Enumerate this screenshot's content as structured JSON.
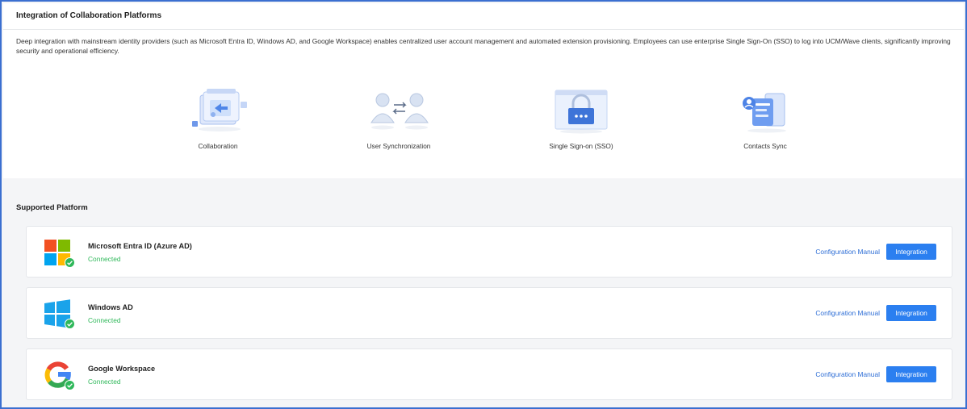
{
  "header": {
    "title": "Integration of Collaboration Platforms",
    "description": "Deep integration with mainstream identity providers (such as Microsoft Entra ID, Windows AD, and Google Workspace) enables centralized user account management and automated extension provisioning. Employees can use enterprise Single Sign-On (SSO) to log into UCM/Wave clients, significantly improving security and operational efficiency."
  },
  "features": [
    {
      "label": "Collaboration",
      "icon": "collaboration-icon"
    },
    {
      "label": "User Synchronization",
      "icon": "user-sync-icon"
    },
    {
      "label": "Single Sign-on (SSO)",
      "icon": "sso-icon"
    },
    {
      "label": "Contacts Sync",
      "icon": "contacts-sync-icon"
    }
  ],
  "supported": {
    "title": "Supported Platform",
    "platforms": [
      {
        "name": "Microsoft Entra ID (Azure AD)",
        "status": "Connected",
        "manual_label": "Configuration Manual",
        "button_label": "Integration",
        "icon": "microsoft-logo-icon"
      },
      {
        "name": "Windows AD",
        "status": "Connected",
        "manual_label": "Configuration Manual",
        "button_label": "Integration",
        "icon": "windows-logo-icon"
      },
      {
        "name": "Google Workspace",
        "status": "Connected",
        "manual_label": "Configuration Manual",
        "button_label": "Integration",
        "icon": "google-logo-icon"
      }
    ]
  },
  "colors": {
    "accent": "#2b7ff0",
    "link": "#2f6fd6",
    "connected": "#2fb85a",
    "frame_border": "#3b6fd0"
  }
}
